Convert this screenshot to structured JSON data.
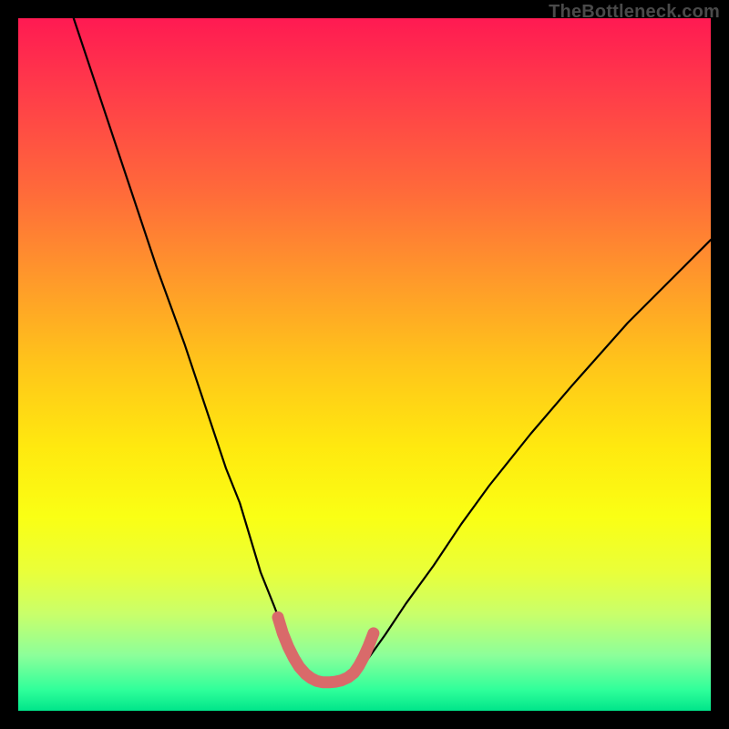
{
  "watermark": {
    "text": "TheBottleneck.com"
  },
  "chart_data": {
    "type": "line",
    "title": "",
    "xlabel": "",
    "ylabel": "",
    "xlim": [
      0,
      100
    ],
    "ylim": [
      0,
      100
    ],
    "series": [
      {
        "name": "bottleneck-curve",
        "x": [
          8,
          12,
          16,
          20,
          24,
          28,
          30,
          32,
          33.5,
          35,
          37,
          38.5,
          39.5,
          40.5,
          42,
          43.5,
          45,
          46.5,
          48,
          49,
          50.5,
          53,
          56,
          60,
          64,
          68,
          74,
          80,
          88,
          96,
          100
        ],
        "y": [
          100,
          88,
          76,
          64,
          53,
          41,
          35,
          30,
          25,
          20,
          15,
          11,
          9,
          7,
          5.2,
          4.4,
          4.1,
          4.2,
          4.6,
          5.5,
          7.5,
          11,
          15.5,
          21,
          27,
          32.5,
          40,
          47,
          56,
          64,
          68
        ]
      },
      {
        "name": "highlight-band",
        "x": [
          37.5,
          38.2,
          39,
          39.8,
          40.6,
          41.5,
          42.3,
          43.1,
          44,
          44.9,
          45.8,
          46.7,
          47.6,
          48.5,
          49.2,
          49.9,
          50.6,
          51.3
        ],
        "y": [
          13.5,
          11.2,
          9.2,
          7.6,
          6.3,
          5.3,
          4.7,
          4.3,
          4.1,
          4.1,
          4.2,
          4.4,
          4.8,
          5.5,
          6.5,
          7.8,
          9.4,
          11.2
        ]
      }
    ],
    "colors": {
      "curve": "#000000",
      "highlight": "#d96a6a",
      "gradient_top": "#ff1a52",
      "gradient_bottom": "#00e58a"
    }
  }
}
